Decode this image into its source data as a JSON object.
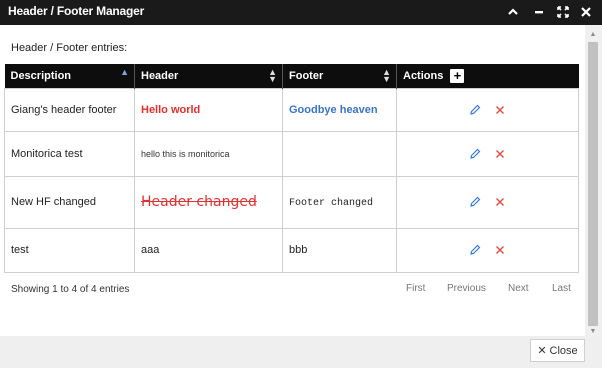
{
  "window": {
    "title": "Header / Footer Manager"
  },
  "section_label": "Header / Footer entries:",
  "table": {
    "columns": [
      "Description",
      "Header",
      "Footer",
      "Actions"
    ],
    "rows": [
      {
        "description": "Giang's header footer",
        "header": "Hello world",
        "footer": "Goodbye heaven"
      },
      {
        "description": "Monitorica test",
        "header": "hello this is monitorica",
        "footer": ""
      },
      {
        "description": "New HF changed",
        "header": "Header changed",
        "footer": "Footer changed"
      },
      {
        "description": "test",
        "header": "aaa",
        "footer": "bbb"
      }
    ]
  },
  "info_text": "Showing 1 to 4 of 4 entries",
  "pagination": {
    "first": "First",
    "previous": "Previous",
    "next": "Next",
    "last": "Last"
  },
  "close_label": "Close",
  "colors": {
    "edit_icon": "#3a7bd5",
    "delete_icon": "#e04a3f"
  }
}
